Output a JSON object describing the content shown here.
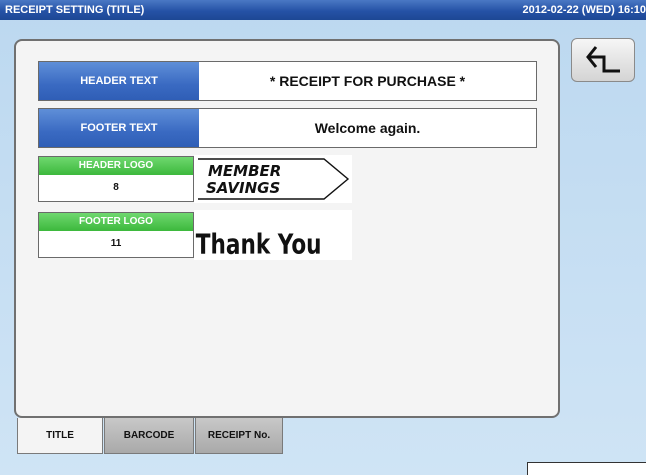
{
  "window": {
    "title": "RECEIPT SETTING (TITLE)",
    "datetime": "2012-02-22 (WED) 16:10"
  },
  "back_button": {
    "icon": "return-arrow-icon"
  },
  "header_text": {
    "label": "HEADER TEXT",
    "value": "* RECEIPT FOR PURCHASE *"
  },
  "footer_text": {
    "label": "FOOTER TEXT",
    "value": "Welcome again."
  },
  "header_logo": {
    "label": "HEADER LOGO",
    "value": "8",
    "image_text_line1": "MEMBER",
    "image_text_line2": "SAVINGS"
  },
  "footer_logo": {
    "label": "FOOTER LOGO",
    "value": "11",
    "image_text": "Thank You"
  },
  "tabs": [
    {
      "label": "TITLE",
      "active": true
    },
    {
      "label": "BARCODE",
      "active": false
    },
    {
      "label": "RECEIPT No.",
      "active": false
    }
  ],
  "colors": {
    "titlebar": "#2552a6",
    "text_label": "#3a6ac2",
    "logo_label": "#3cb83c"
  }
}
